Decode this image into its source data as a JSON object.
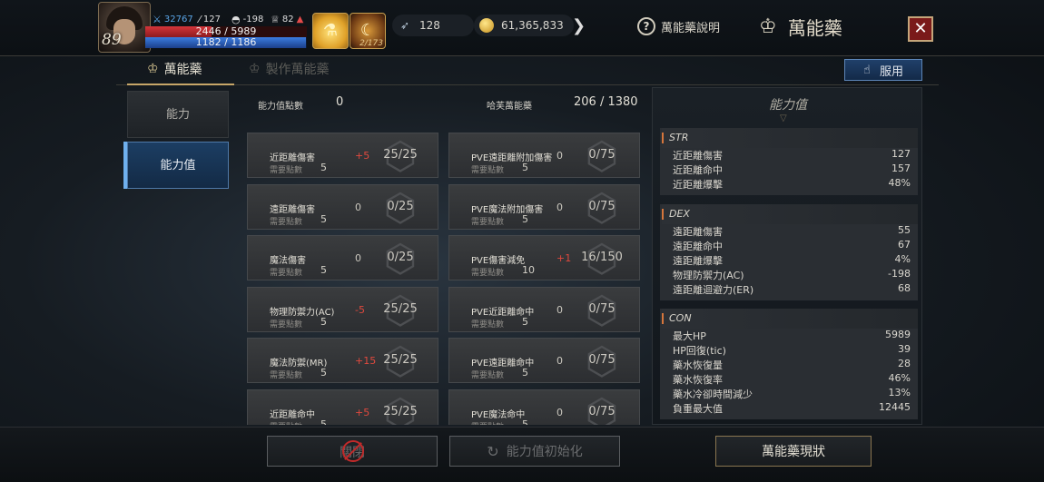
{
  "hud": {
    "level": "89",
    "stats": {
      "power": "32767",
      "str": "127",
      "ac": "-198",
      "trophy": "82"
    },
    "hp": {
      "text": "2446 / 5989",
      "fraction": 0.408
    },
    "mp": {
      "text": "1182 / 1186",
      "fraction": 0.997
    },
    "buff2_count": "2/173",
    "currency1": "128",
    "currency2": "61,365,833",
    "help_label": "萬能藥說明",
    "title": "萬能藥"
  },
  "tabs": {
    "active": "萬能藥",
    "inactive": "製作萬能藥",
    "use_button": "服用"
  },
  "side_menu": {
    "item1": "能力",
    "item2": "能力值"
  },
  "center": {
    "points_label": "能力值點數",
    "points_value": "0",
    "pool_label": "哈芙萬能藥",
    "pool_value": "206 / 1380",
    "req_label": "需要點數",
    "left_cards": [
      {
        "name": "近距離傷害",
        "req": "5",
        "bonus": "+5",
        "value": "25/25"
      },
      {
        "name": "遠距離傷害",
        "req": "5",
        "bonus": "0",
        "value": "0/25"
      },
      {
        "name": "魔法傷害",
        "req": "5",
        "bonus": "0",
        "value": "0/25"
      },
      {
        "name": "物理防禦力(AC)",
        "req": "5",
        "bonus": "-5",
        "value": "25/25"
      },
      {
        "name": "魔法防禦(MR)",
        "req": "5",
        "bonus": "+15",
        "value": "25/25"
      },
      {
        "name": "近距離命中",
        "req": "5",
        "bonus": "+5",
        "value": "25/25"
      }
    ],
    "right_cards": [
      {
        "name": "PVE遠距離附加傷害",
        "req": "5",
        "bonus": "0",
        "value": "0/75"
      },
      {
        "name": "PVE魔法附加傷害",
        "req": "5",
        "bonus": "0",
        "value": "0/75"
      },
      {
        "name": "PVE傷害減免",
        "req": "10",
        "bonus": "+1",
        "value": "16/150"
      },
      {
        "name": "PVE近距離命中",
        "req": "5",
        "bonus": "0",
        "value": "0/75"
      },
      {
        "name": "PVE遠距離命中",
        "req": "5",
        "bonus": "0",
        "value": "0/75"
      },
      {
        "name": "PVE魔法命中",
        "req": "5",
        "bonus": "0",
        "value": "0/75"
      }
    ]
  },
  "stats_panel": {
    "title": "能力值",
    "str": {
      "head": "STR",
      "rows": [
        [
          "近距離傷害",
          "127"
        ],
        [
          "近距離命中",
          "157"
        ],
        [
          "近距離爆擊",
          "48%"
        ]
      ]
    },
    "dex": {
      "head": "DEX",
      "rows": [
        [
          "遠距離傷害",
          "55"
        ],
        [
          "遠距離命中",
          "67"
        ],
        [
          "遠距離爆擊",
          "4%"
        ],
        [
          "物理防禦力(AC)",
          "-198"
        ],
        [
          "遠距離迴避力(ER)",
          "68"
        ]
      ]
    },
    "con": {
      "head": "CON",
      "rows": [
        [
          "最大HP",
          "5989"
        ],
        [
          "HP回復(tic)",
          "39"
        ],
        [
          "藥水恢復量",
          "28"
        ],
        [
          "藥水恢復率",
          "46%"
        ],
        [
          "藥水冷卻時間減少",
          "13%"
        ],
        [
          "負重最大值",
          "12445"
        ]
      ]
    }
  },
  "bottom": {
    "close_label": "關閉",
    "reset_label": "能力值初始化",
    "status_label": "萬能藥現狀"
  },
  "colors": {
    "hp": "#c8282e",
    "mp": "#2f6fd6",
    "accent": "#c7a668",
    "bonus_red": "#e0493e",
    "selected_blue": "#1c3e63"
  }
}
